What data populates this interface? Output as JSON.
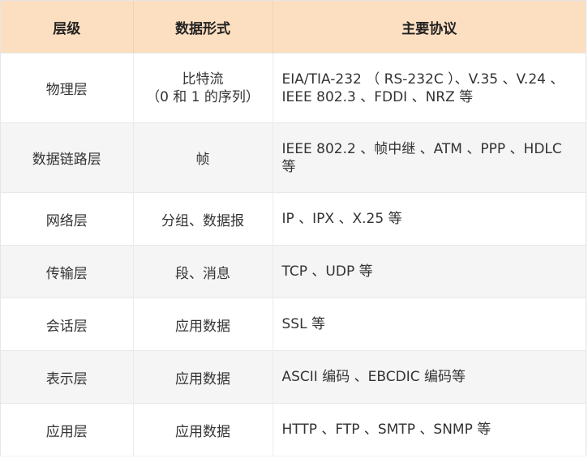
{
  "header": {
    "col_layer": "层级",
    "col_format": "数据形式",
    "col_protocols": "主要协议"
  },
  "rows": [
    {
      "layer": "物理层",
      "format_line1": "比特流",
      "format_line2": "（0 和 1 的序列）",
      "protocols": "EIA/TIA-232 （ RS-232C ）、V.35 、V.24 、IEEE 802.3 、FDDI 、NRZ 等"
    },
    {
      "layer": "数据链路层",
      "format_line1": "帧",
      "format_line2": "",
      "protocols": "IEEE 802.2 、帧中继 、ATM 、PPP 、HDLC 等"
    },
    {
      "layer": "网络层",
      "format_line1": "分组、数据报",
      "format_line2": "",
      "protocols": "IP 、IPX 、X.25 等"
    },
    {
      "layer": "传输层",
      "format_line1": "段、消息",
      "format_line2": "",
      "protocols": "TCP 、UDP 等"
    },
    {
      "layer": "会话层",
      "format_line1": "应用数据",
      "format_line2": "",
      "protocols": "SSL 等"
    },
    {
      "layer": "表示层",
      "format_line1": "应用数据",
      "format_line2": "",
      "protocols": "ASCII 编码 、EBCDIC 编码等"
    },
    {
      "layer": "应用层",
      "format_line1": "应用数据",
      "format_line2": "",
      "protocols": "HTTP 、FTP 、SMTP 、SNMP 等"
    }
  ],
  "colors": {
    "header_bg": "#fcdfc1",
    "stripe_bg": "#f5f5f5",
    "text": "#333333"
  }
}
